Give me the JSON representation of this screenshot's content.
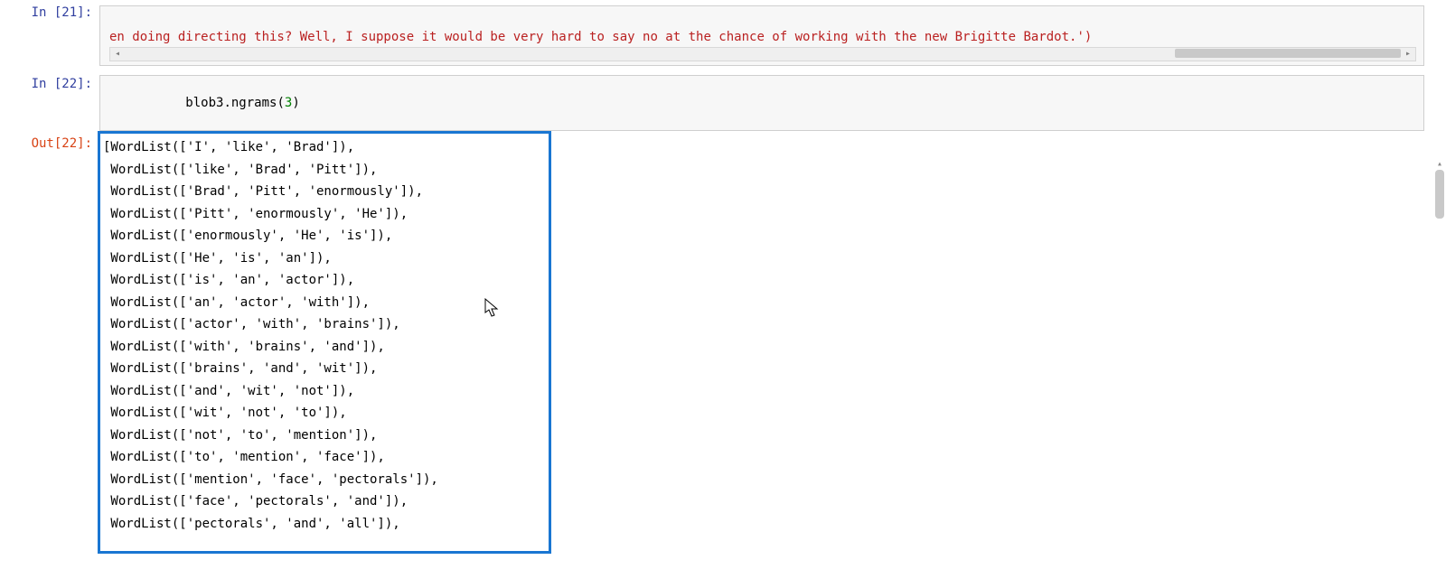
{
  "cell21": {
    "prompt": "In [21]:",
    "code_string": "en doing directing this? Well, I suppose it would be very hard to say no at the chance of working with the new Brigitte Bardot.')"
  },
  "cell22": {
    "prompt": "In [22]:",
    "code": "blob3.ngrams(3)",
    "code_obj": "blob3",
    "code_method": ".ngrams(",
    "code_arg": "3",
    "code_close": ")"
  },
  "out22": {
    "prompt": "Out[22]:",
    "lines": [
      "[WordList(['I', 'like', 'Brad']),",
      " WordList(['like', 'Brad', 'Pitt']),",
      " WordList(['Brad', 'Pitt', 'enormously']),",
      " WordList(['Pitt', 'enormously', 'He']),",
      " WordList(['enormously', 'He', 'is']),",
      " WordList(['He', 'is', 'an']),",
      " WordList(['is', 'an', 'actor']),",
      " WordList(['an', 'actor', 'with']),",
      " WordList(['actor', 'with', 'brains']),",
      " WordList(['with', 'brains', 'and']),",
      " WordList(['brains', 'and', 'wit']),",
      " WordList(['and', 'wit', 'not']),",
      " WordList(['wit', 'not', 'to']),",
      " WordList(['not', 'to', 'mention']),",
      " WordList(['to', 'mention', 'face']),",
      " WordList(['mention', 'face', 'pectorals']),",
      " WordList(['face', 'pectorals', 'and']),",
      " WordList(['pectorals', 'and', 'all']),"
    ]
  }
}
